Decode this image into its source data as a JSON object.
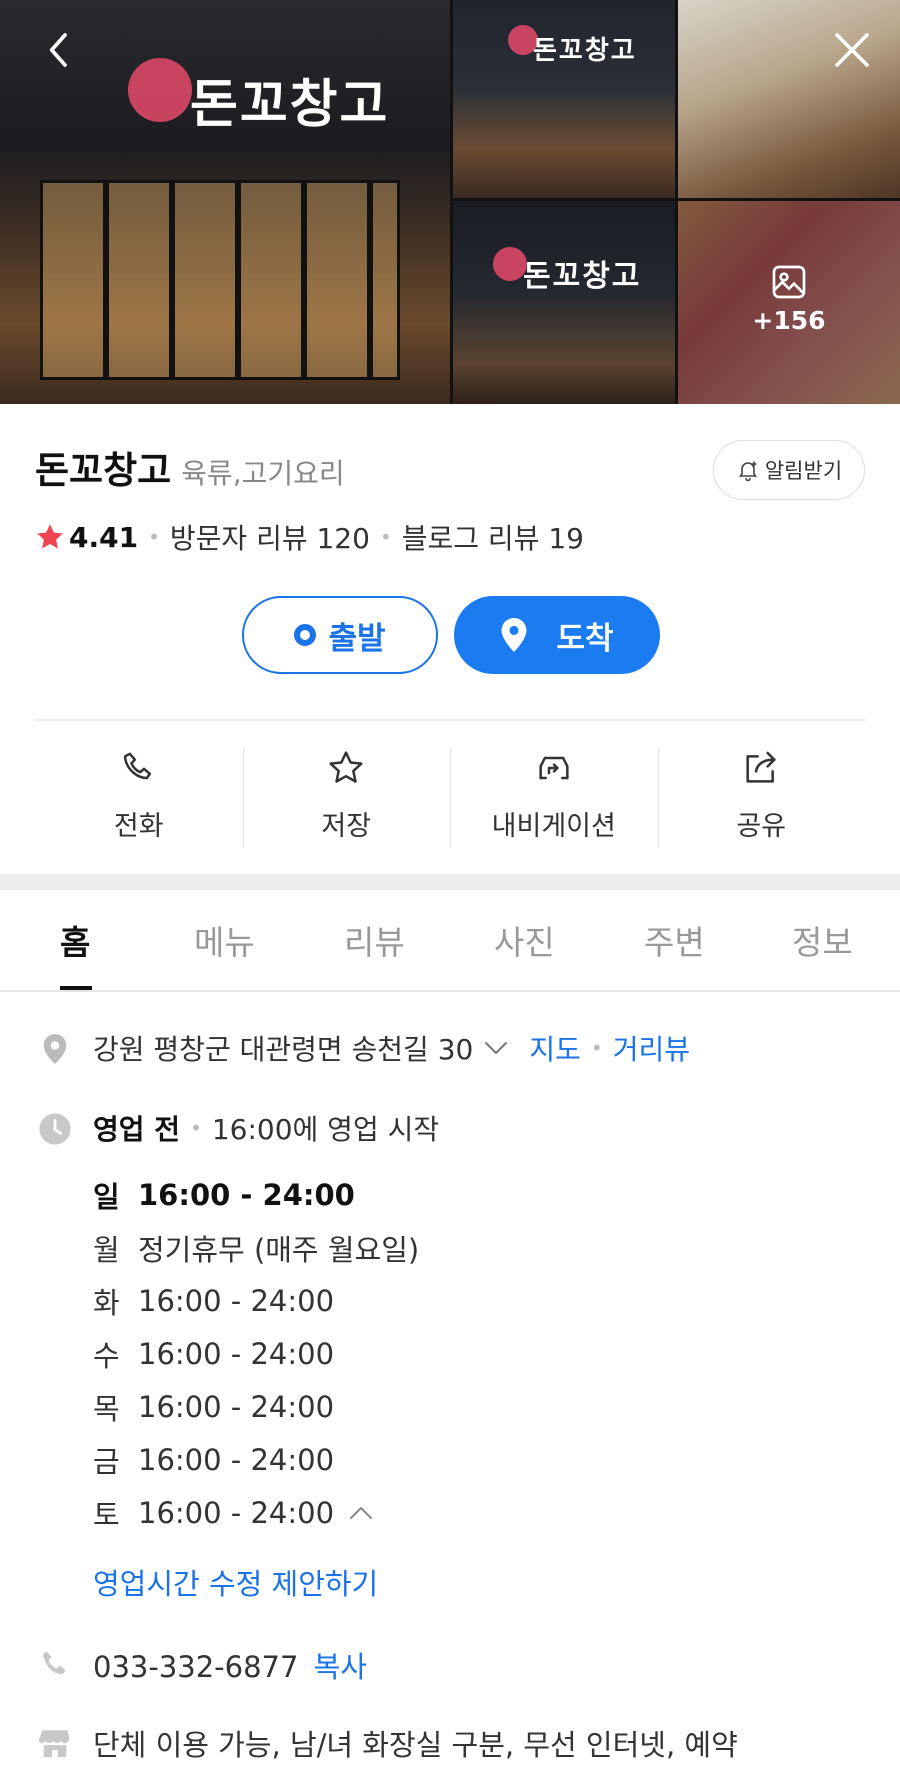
{
  "gallery": {
    "sign_text": "돈꼬창고",
    "more_count": "+156"
  },
  "place": {
    "name": "돈꼬창고",
    "category": "육류,고기요리",
    "alarm_label": "알림받기",
    "rating": "4.41",
    "visitor_reviews": "방문자 리뷰 120",
    "blog_reviews": "블로그 리뷰 19"
  },
  "directions": {
    "start_label": "출발",
    "end_label": "도착"
  },
  "actions": [
    {
      "label": "전화",
      "icon": "phone-icon"
    },
    {
      "label": "저장",
      "icon": "star-outline-icon"
    },
    {
      "label": "내비게이션",
      "icon": "navigation-car-icon"
    },
    {
      "label": "공유",
      "icon": "share-icon"
    }
  ],
  "tabs": [
    "홈",
    "메뉴",
    "리뷰",
    "사진",
    "주변",
    "정보"
  ],
  "details": {
    "address": "강원 평창군 대관령면 송천길 30",
    "map_link": "지도",
    "roadview_link": "거리뷰",
    "status": "영업 전",
    "status_note": "16:00에 영업 시작",
    "hours": [
      {
        "day": "일",
        "time": "16:00 - 24:00"
      },
      {
        "day": "월",
        "time": "정기휴무 (매주 월요일)"
      },
      {
        "day": "화",
        "time": "16:00 - 24:00"
      },
      {
        "day": "수",
        "time": "16:00 - 24:00"
      },
      {
        "day": "목",
        "time": "16:00 - 24:00"
      },
      {
        "day": "금",
        "time": "16:00 - 24:00"
      },
      {
        "day": "토",
        "time": "16:00 - 24:00"
      }
    ],
    "suggest_edit": "영업시간 수정 제안하기",
    "phone": "033-332-6877",
    "copy_label": "복사",
    "amenities": "단체 이용 가능, 남/녀 화장실 구분, 무선 인터넷, 예약"
  },
  "colors": {
    "accent": "#1a73e8",
    "star": "#f04452"
  }
}
